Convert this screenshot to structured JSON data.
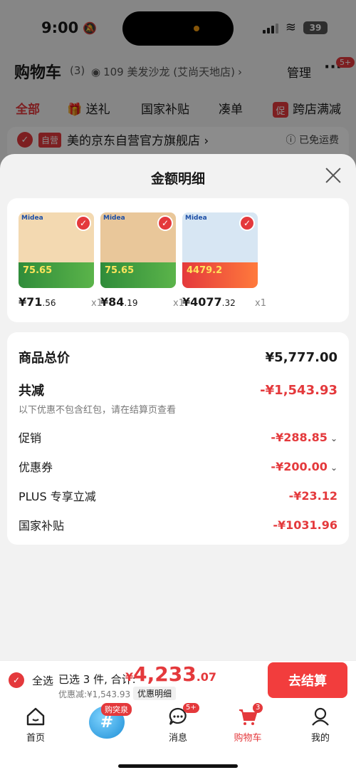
{
  "status": {
    "time": "9:00",
    "battery": "39"
  },
  "header": {
    "title": "购物车",
    "count": "(3)",
    "location": "109 美发沙龙 (艾尚天地店)",
    "manage": "管理",
    "more_badge": "5+"
  },
  "filters": [
    {
      "label": "全部"
    },
    {
      "label": "送礼"
    },
    {
      "label": "国家补贴"
    },
    {
      "label": "凑单"
    },
    {
      "label": "跨店满减",
      "tag": "促"
    }
  ],
  "store": {
    "tag": "自营",
    "name": "美的京东自营官方旗舰店 ›",
    "shipping": "ⓘ 已免运费"
  },
  "sheet": {
    "title": "金额明细",
    "products": [
      {
        "brand": "Midea",
        "promo": "75.65",
        "price_int": "¥71",
        "price_dec": ".56",
        "qty": "x1",
        "color": "#f3d9b1"
      },
      {
        "brand": "Midea",
        "promo": "75.65",
        "price_int": "¥84",
        "price_dec": ".19",
        "qty": "x1",
        "color": "#e9c79a"
      },
      {
        "brand": "Midea",
        "promo": "4479.2",
        "price_int": "¥4077",
        "price_dec": ".32",
        "qty": "x1",
        "color": "#d7e6f3"
      }
    ],
    "summary": {
      "total_label": "商品总价",
      "total_value": "¥5,777.00",
      "reduce_label": "共减",
      "reduce_value": "-¥1,543.93",
      "note": "以下优惠不包含红包，请在结算页查看",
      "rows": [
        {
          "label": "促销",
          "value": "-¥288.85",
          "chevron": true
        },
        {
          "label": "优惠券",
          "value": "-¥200.00",
          "chevron": true
        },
        {
          "label": "PLUS 专享立减",
          "value": "-¥23.12",
          "chevron": false
        },
        {
          "label": "国家补贴",
          "value": "-¥1031.96",
          "chevron": false
        }
      ]
    }
  },
  "checkout": {
    "select_all": "全选",
    "selected": "已选 3 件, 合计:",
    "yen": "¥",
    "total_int": "4,233",
    "total_dec": ".07",
    "discount": "优惠减:¥1,543.93",
    "detail": "优惠明细",
    "button": "去结算"
  },
  "tabs": [
    {
      "label": "首页"
    },
    {
      "label": "",
      "badge": "购突泉"
    },
    {
      "label": "消息",
      "badge": "5+"
    },
    {
      "label": "购物车",
      "badge": "3"
    },
    {
      "label": "我的"
    }
  ]
}
